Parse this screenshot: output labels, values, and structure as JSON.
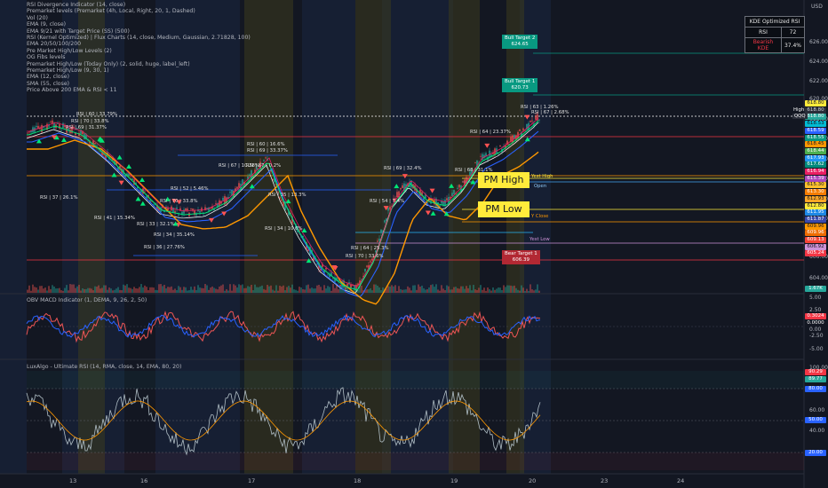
{
  "indicators": {
    "main": [
      "RSI Divergence Indicator (14, close)",
      "Premarket levels (Premarket (4h, Local, Right, 20, 1, Dashed)",
      "Vol (20)",
      "EMA (9, close)",
      "EMA 9/21 with Target Price (SS) (500)",
      "RSI (Kernel Optimized) | Flux Charts (14, close, Medium, Gaussian, 2.71828, 100)",
      "EMA 20/50/100/200",
      "Pre Market High/Low Levels (2)",
      "OG Fibs levels",
      "Premarket High/Low (Today Only) (2, solid, huge, label_left)",
      "Premarket High/Low (9, 30, 1)",
      "EMA (12, close)",
      "SMA (55, close)",
      "Price Above 200 EMA & RSI < 11"
    ],
    "obv": "OBV MACD Indicator (1, DEMA, 9, 26, 2, 50)",
    "lux": "LuxAlgo - Ultimate RSI (14, RMA, close, 14, EMA, 80, 20)"
  },
  "kde_table": {
    "title": "KDE Optimized RSI",
    "rsi_label": "RSI",
    "rsi_value": "72",
    "signal_label": "Bearish KDE",
    "signal_value": "37.4%"
  },
  "currency": "USD",
  "price_axis": [
    "626.00",
    "624.00",
    "622.00",
    "620.00",
    "618.00",
    "616.00",
    "614.00",
    "612.00",
    "610.00",
    "608.00",
    "606.00",
    "604.00"
  ],
  "price_badges": [
    {
      "text": "618.80",
      "color": "#ffeb3b",
      "fg": "#131722"
    },
    {
      "text": "618.80",
      "color": "#2a2e39",
      "fg": "#d1d4dc"
    },
    {
      "text": "618.80",
      "color": "#26a69a",
      "fg": "#ffffff"
    },
    {
      "text": "618.53",
      "color": "#00bcd4",
      "fg": "#131722"
    },
    {
      "text": "618.59",
      "color": "#2962ff",
      "fg": "#ffffff"
    },
    {
      "text": "618.55",
      "color": "#089981",
      "fg": "#ffffff"
    },
    {
      "text": "618.45",
      "color": "#ff9800",
      "fg": "#131722"
    },
    {
      "text": "618.44",
      "color": "#4caf50",
      "fg": "#ffffff"
    },
    {
      "text": "617.93",
      "color": "#2196f3",
      "fg": "#ffffff"
    },
    {
      "text": "617.62",
      "color": "#00897b",
      "fg": "#ffffff"
    },
    {
      "text": "616.94",
      "color": "#e91e63",
      "fg": "#ffffff"
    },
    {
      "text": "615.39",
      "color": "#ab47bc",
      "fg": "#ffffff"
    },
    {
      "text": "615.30",
      "color": "#fbc02d",
      "fg": "#131722"
    },
    {
      "text": "613.30",
      "color": "#f57c00",
      "fg": "#ffffff"
    },
    {
      "text": "612.93",
      "color": "#ffa726",
      "fg": "#131722"
    },
    {
      "text": "612.80",
      "color": "#ffeb3b",
      "fg": "#131722"
    },
    {
      "text": "611.95",
      "color": "#1e88e5",
      "fg": "#ffffff"
    },
    {
      "text": "611.87",
      "color": "#3949ab",
      "fg": "#ffffff"
    },
    {
      "text": "609.96",
      "color": "#ff9800",
      "fg": "#131722"
    },
    {
      "text": "609.96",
      "color": "#ef6c00",
      "fg": "#ffffff"
    },
    {
      "text": "609.13",
      "color": "#f44336",
      "fg": "#ffffff"
    },
    {
      "text": "606.92",
      "color": "#ce93d8",
      "fg": "#131722"
    },
    {
      "text": "605.24",
      "color": "#f23645",
      "fg": "#ffffff"
    },
    {
      "text": "1.67K",
      "color": "#26a69a",
      "fg": "#ffffff"
    }
  ],
  "qqq_label": "QQQ",
  "high_label": "High",
  "obv_axis": [
    "5.00",
    "2.50",
    "0.00",
    "-2.50",
    "-5.00"
  ],
  "obv_badges": [
    {
      "text": "0.3024",
      "color": "#f23645"
    },
    {
      "text": "0.0000",
      "color": "#131722"
    }
  ],
  "lux_axis": [
    "100.00",
    "80.00",
    "60.00",
    "40.00",
    "20.00"
  ],
  "lux_badges": [
    {
      "text": "90.29",
      "color": "#f23645"
    },
    {
      "text": "89.77",
      "color": "#26a69a"
    },
    {
      "text": "80.00",
      "color": "#2962ff"
    },
    {
      "text": "50.00",
      "color": "#2962ff"
    },
    {
      "text": "20.00",
      "color": "#2962ff"
    }
  ],
  "x_axis": [
    "13",
    "16",
    "17",
    "18",
    "19",
    "20",
    "23",
    "24"
  ],
  "targets": {
    "bull2": {
      "label": "Bull Target 2",
      "value": "624.65"
    },
    "bull1": {
      "label": "Bull Target 1",
      "value": "620.73"
    },
    "bear1": {
      "label": "Bear Target 1",
      "value": "606.39"
    }
  },
  "pm_high": "PM High",
  "pm_low": "PM Low",
  "level_labels": {
    "yest_high": "Yest High",
    "open": "Open",
    "y_close": "Y Close",
    "yest_low": "Yest Low",
    "high": "High"
  },
  "rsi_tags": [
    "RSI | 60 | 33.79%",
    "RSI | 70 | 33.8%",
    "RSI | 69 | 31.37%",
    "RSI | 37 | 26.1%",
    "RSI | 52 | 5.46%",
    "RSI | 70 | 33.8%",
    "RSI | 41 | 15.34%",
    "RSI | 33 | 32.1%",
    "RSI | 34 | 35.14%",
    "RSI | 36 | 27.76%",
    "RSI | 60 | 16.6%",
    "RSI | 69 | 33.37%",
    "RSI | 67 | 10.28%",
    "RSI | 67 | 0.2%",
    "RSI | 35 | 13.3%",
    "RSI | 34 | 10.6%",
    "RSI | 69 | 32.4%",
    "RSI | 54 | 7.4%",
    "RSI | 68 | 31.1%",
    "RSI | 64 | 23.37%",
    "RSI | 64 | 25.3%",
    "RSI | 70 | 33.6%",
    "RSI | 63 | 1.26%",
    "RSI | 67 | 2.68%"
  ]
}
